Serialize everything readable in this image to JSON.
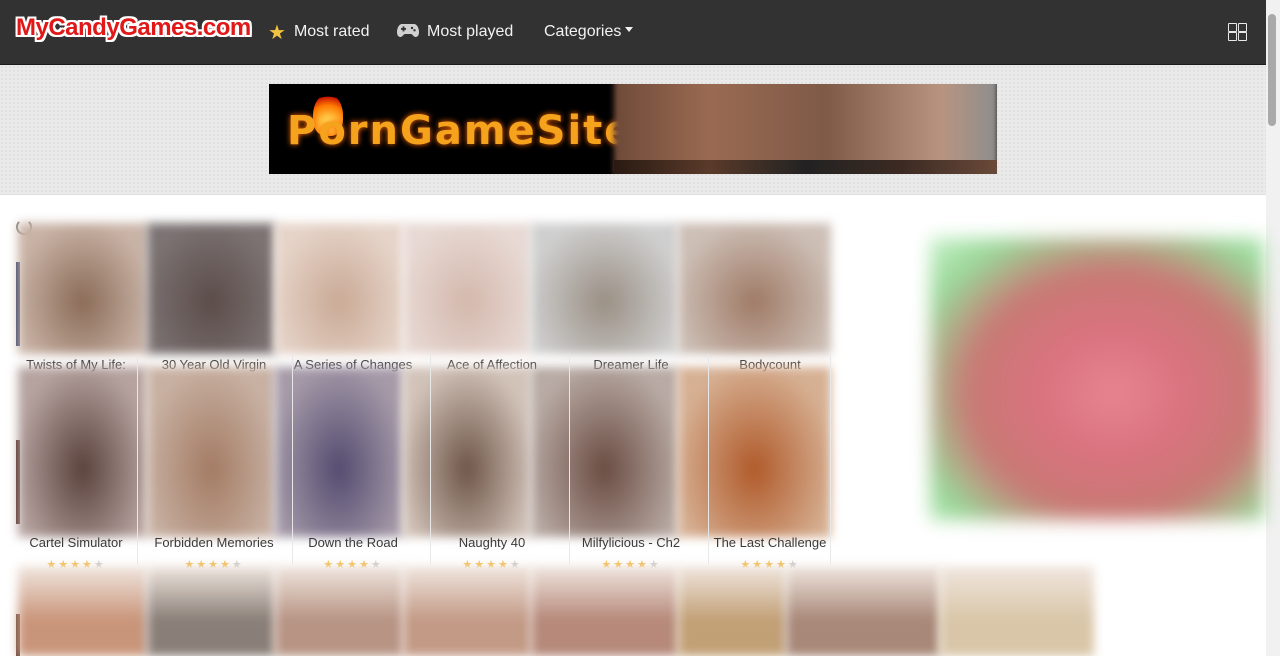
{
  "site": {
    "logo_text": "MyCandyGames.com"
  },
  "nav": {
    "items": [
      {
        "label": "Most rated",
        "icon": "star-icon"
      },
      {
        "label": "Most played",
        "icon": "gamepad-icon"
      },
      {
        "label": "Categories",
        "icon": "caret-down-icon"
      }
    ],
    "layout_toggle_icon": "grid-layout-icon"
  },
  "banner": {
    "ad_text": "PornGameSite"
  },
  "games_row1": [
    {
      "title": "Twists of My Life:",
      "thumb": [
        "#c9b3a6",
        "#8a6b57"
      ]
    },
    {
      "title": "30 Year Old Virgin",
      "thumb": [
        "#7c7373",
        "#5b4c49"
      ]
    },
    {
      "title": "A Series of Changes",
      "thumb": [
        "#e6d4c9",
        "#c9a995"
      ]
    },
    {
      "title": "Ace of Affection",
      "thumb": [
        "#e8d9d4",
        "#d3b8ac"
      ]
    },
    {
      "title": "Dreamer Life",
      "thumb": [
        "#cfcfcf",
        "#9a8f84"
      ]
    },
    {
      "title": "Bodycount",
      "thumb": [
        "#cdbfb6",
        "#9f7a66"
      ]
    }
  ],
  "games_row2": [
    {
      "title": "Cartel Simulator",
      "rating": 4,
      "thumb": [
        "#b6a3a0",
        "#5a423c"
      ]
    },
    {
      "title": "Forbidden Memories",
      "rating": 4,
      "thumb": [
        "#c8b1a3",
        "#a37b63"
      ]
    },
    {
      "title": "Down the Road",
      "rating": 4,
      "thumb": [
        "#a59aa8",
        "#544b70"
      ]
    },
    {
      "title": "Naughty 40",
      "rating": 4,
      "thumb": [
        "#d2c3b9",
        "#6e5548"
      ]
    },
    {
      "title": "Milfylicious - Ch2",
      "rating": 4,
      "thumb": [
        "#b8aaa4",
        "#6a4c42"
      ]
    },
    {
      "title": "The Last Challenge",
      "rating": 4,
      "thumb": [
        "#d6b093",
        "#b05a2a"
      ]
    }
  ],
  "colors": {
    "navbar": "#323232",
    "logo_red": "#e01818",
    "star_gold": "#f4b635"
  }
}
